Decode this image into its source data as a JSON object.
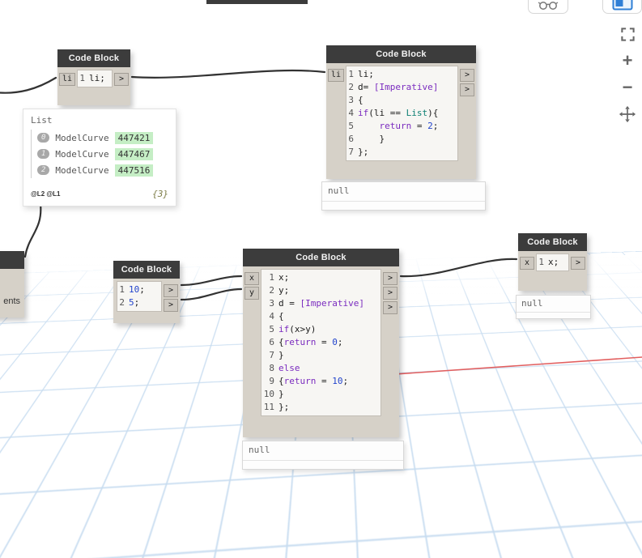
{
  "colors": {
    "node_header": "#3c3c3c",
    "node_body": "#d6d1c8",
    "grid": "#c7dcf0",
    "axis_x": "#e25f5f",
    "wire": "#333333",
    "value_highlight": "#c5eec5",
    "keyword": "#7a2bbf",
    "number_literal": "#2244cc",
    "type_name": "#0e8074"
  },
  "view_controls": {
    "zoom_in": "+",
    "zoom_out": "−"
  },
  "nodes": {
    "cb_a": {
      "title": "Code Block",
      "in_ports": [
        "li"
      ],
      "out_ports": [
        ">"
      ],
      "lines": [
        {
          "num": "1",
          "tokens": [
            {
              "t": "li;",
              "c": "plain"
            }
          ]
        }
      ]
    },
    "cb_b": {
      "title": "Code Block",
      "in_ports": [
        "li"
      ],
      "out_ports": [
        ">",
        ">"
      ],
      "preview": "null",
      "lines": [
        {
          "num": "1",
          "tokens": [
            {
              "t": "li;",
              "c": "plain"
            }
          ]
        },
        {
          "num": "2",
          "tokens": [
            {
              "t": "d= ",
              "c": "plain"
            },
            {
              "t": "[Imperative]",
              "c": "kw"
            }
          ]
        },
        {
          "num": "3",
          "tokens": [
            {
              "t": "{",
              "c": "plain"
            }
          ]
        },
        {
          "num": "4",
          "tokens": [
            {
              "t": "if",
              "c": "kw"
            },
            {
              "t": "(li == ",
              "c": "plain"
            },
            {
              "t": "List",
              "c": "type"
            },
            {
              "t": "){",
              "c": "plain"
            }
          ]
        },
        {
          "num": "5",
          "tokens": [
            {
              "t": "    ",
              "c": "plain"
            },
            {
              "t": "return",
              "c": "kw"
            },
            {
              "t": " = ",
              "c": "plain"
            },
            {
              "t": "2",
              "c": "num"
            },
            {
              "t": ";",
              "c": "plain"
            }
          ]
        },
        {
          "num": "6",
          "tokens": [
            {
              "t": "    }",
              "c": "plain"
            }
          ]
        },
        {
          "num": "7",
          "tokens": [
            {
              "t": "};",
              "c": "plain"
            }
          ]
        }
      ]
    },
    "cb_e": {
      "title": "Code Block",
      "in_ports": [],
      "out_ports": [
        ">",
        ">"
      ],
      "lines": [
        {
          "num": "1",
          "tokens": [
            {
              "t": "10",
              "c": "num"
            },
            {
              "t": ";",
              "c": "plain"
            }
          ]
        },
        {
          "num": "2",
          "tokens": [
            {
              "t": "5",
              "c": "num"
            },
            {
              "t": ";",
              "c": "plain"
            }
          ]
        }
      ]
    },
    "cb_f": {
      "title": "Code Block",
      "in_ports": [
        "x",
        "y"
      ],
      "out_ports": [
        ">",
        ">",
        ">"
      ],
      "preview": "null",
      "lines": [
        {
          "num": "1",
          "tokens": [
            {
              "t": "x;",
              "c": "plain"
            }
          ]
        },
        {
          "num": "2",
          "tokens": [
            {
              "t": "y;",
              "c": "plain"
            }
          ]
        },
        {
          "num": "3",
          "tokens": [
            {
              "t": "d = ",
              "c": "plain"
            },
            {
              "t": "[Imperative]",
              "c": "kw"
            }
          ]
        },
        {
          "num": "4",
          "tokens": [
            {
              "t": "{",
              "c": "plain"
            }
          ]
        },
        {
          "num": "5",
          "tokens": [
            {
              "t": "if",
              "c": "kw"
            },
            {
              "t": "(x>y)",
              "c": "plain"
            }
          ]
        },
        {
          "num": "6",
          "tokens": [
            {
              "t": "{",
              "c": "plain"
            },
            {
              "t": "return",
              "c": "kw"
            },
            {
              "t": " = ",
              "c": "plain"
            },
            {
              "t": "0",
              "c": "num"
            },
            {
              "t": ";",
              "c": "plain"
            }
          ]
        },
        {
          "num": "7",
          "tokens": [
            {
              "t": "}",
              "c": "plain"
            }
          ]
        },
        {
          "num": "8",
          "tokens": [
            {
              "t": "else",
              "c": "kw"
            }
          ]
        },
        {
          "num": "9",
          "tokens": [
            {
              "t": "{",
              "c": "plain"
            },
            {
              "t": "return",
              "c": "kw"
            },
            {
              "t": " = ",
              "c": "plain"
            },
            {
              "t": "10",
              "c": "num"
            },
            {
              "t": ";",
              "c": "plain"
            }
          ]
        },
        {
          "num": "10",
          "tokens": [
            {
              "t": "}",
              "c": "plain"
            }
          ]
        },
        {
          "num": "11",
          "tokens": [
            {
              "t": "};",
              "c": "plain"
            }
          ]
        }
      ]
    },
    "cb_g": {
      "title": "Code Block",
      "in_ports": [
        "x"
      ],
      "out_ports": [
        ">"
      ],
      "preview": "null",
      "lines": [
        {
          "num": "1",
          "tokens": [
            {
              "t": "x;",
              "c": "plain"
            }
          ]
        }
      ]
    },
    "partial_left": {
      "visible_text": "ents"
    }
  },
  "list_preview": {
    "title": "List",
    "rows": [
      {
        "index": "0",
        "name": "ModelCurve",
        "value": "447421"
      },
      {
        "index": "1",
        "name": "ModelCurve",
        "value": "447467"
      },
      {
        "index": "2",
        "name": "ModelCurve",
        "value": "447516"
      }
    ],
    "levels": "@L2 @L1",
    "count": "{3}"
  }
}
